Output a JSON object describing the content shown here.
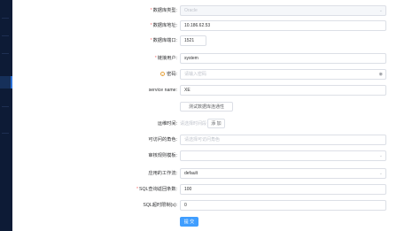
{
  "form": {
    "db_type": {
      "label": "数据库类型:",
      "value": "Oracle",
      "required": true
    },
    "db_address": {
      "label": "数据库地址:",
      "value": "10.186.62.53",
      "required": true
    },
    "db_port": {
      "label": "数据库端口:",
      "value": "1521",
      "required": true
    },
    "conn_user": {
      "label": "链接用户:",
      "value": "system",
      "required": true
    },
    "password": {
      "label": "密码:",
      "placeholder": "请输入密码",
      "info_icon": "warning-circle-icon",
      "eye_icon": "eye-icon"
    },
    "service_name": {
      "label": "service name:",
      "value": "XE"
    },
    "test_button": "测试数据库连通性",
    "maintenance": {
      "label": "运维时间:",
      "placeholder": "请选择时间段",
      "add_button": "添 加"
    },
    "access_roles": {
      "label": "可访问的角色:",
      "placeholder": "请选择可访问角色"
    },
    "audit_rule": {
      "label": "审核规则模板:",
      "value": ""
    },
    "workflow": {
      "label": "应用的工作流:",
      "value": "default"
    },
    "sql_max_rows": {
      "label": "SQL查询返回条数:",
      "value": "100",
      "required": true
    },
    "sql_timeout": {
      "label": "SQL超时限制(s):",
      "value": "0"
    },
    "submit_button": "提 交"
  },
  "colors": {
    "primary": "#409eff",
    "required": "#f56c6c",
    "sidebar": "#0d1b36"
  }
}
